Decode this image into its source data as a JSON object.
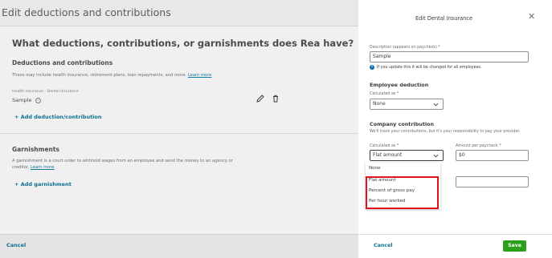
{
  "background": {
    "header_title": "Edit deductions and contributions",
    "question": "What deductions, contributions, or garnishments does Rea have?",
    "deductions": {
      "title": "Deductions and contributions",
      "description": "These may include health insurance, retirement plans, loan repayments, and more.",
      "learn_more": "Learn more",
      "item_category": "Health insurance - Dental Insurance",
      "item_name": "Sample",
      "add_label": "+ Add deduction/contribution"
    },
    "garnishments": {
      "title": "Garnishments",
      "description_line1": "A garnishment is a court order to withhold wages from an employee and send the money to an agency or",
      "description_line2": "creditor.",
      "learn_more": "Learn more",
      "add_label": "+ Add garnishment"
    },
    "footer_cancel": "Cancel"
  },
  "panel": {
    "title": "Edit Dental Insurance",
    "close_icon": "close-icon",
    "description_label": "Description (appears on paycheck) *",
    "description_value": "Sample",
    "info_note": "If you update this it will be changed for all employees.",
    "employee_deduction": {
      "heading": "Employee deduction",
      "calc_label": "Calculated as *",
      "calc_value": "None"
    },
    "company_contribution": {
      "heading": "Company contribution",
      "note": "We'll track your contributions, but it's your responsibility to pay your provider.",
      "calc_label": "Calculated as *",
      "calc_value": "Flat amount",
      "amount_label": "Amount per paycheck *",
      "amount_value": "$0",
      "options": [
        "None",
        "Flat amount",
        "Percent of gross pay",
        "Per hour worked"
      ]
    },
    "footer": {
      "cancel": "Cancel",
      "save": "Save"
    }
  },
  "colors": {
    "accent_link": "#0c6f93",
    "save_green": "#2ca01c",
    "highlight_red": "#e0131c",
    "info_blue": "#0d6db0"
  }
}
